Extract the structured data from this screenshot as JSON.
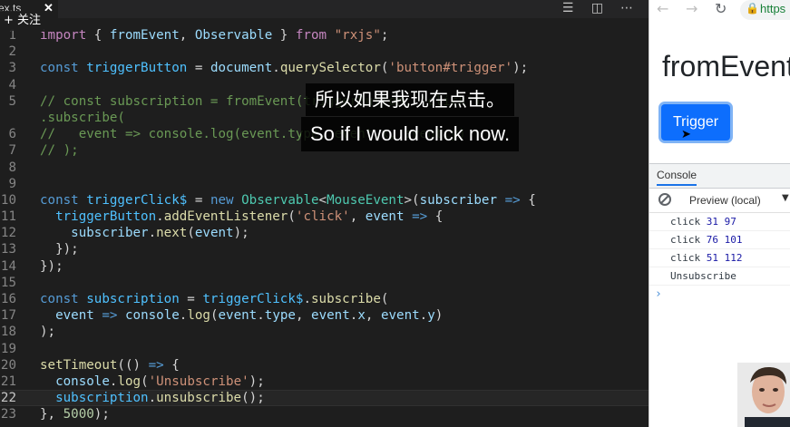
{
  "editor": {
    "tab": {
      "label": "ex.ts",
      "close": "✕"
    },
    "follow_badge": "+ 关注",
    "actions": [
      "☰",
      "◫",
      "⋯"
    ],
    "lines": [
      {
        "n": "1",
        "html": "<span class=\"kw\">import</span> { <span class=\"var\">fromEvent</span>, <span class=\"var\">Observable</span> } <span class=\"kw\">from</span> <span class=\"str\">\"rxjs\"</span>;"
      },
      {
        "n": "2",
        "html": ""
      },
      {
        "n": "3",
        "html": "<span class=\"decl\">const</span> <span class=\"const\">triggerButton</span> = <span class=\"var\">document</span>.<span class=\"fn\">querySelector</span>(<span class=\"str\">'button#trigger'</span>);"
      },
      {
        "n": "4",
        "html": ""
      },
      {
        "n": "5",
        "html": "<span class=\"cmt\">// const subscription = fromEvent(triggerButton, 'click')</span>"
      },
      {
        "n": "",
        "html": "<span class=\"cmt\">.subscribe(</span>"
      },
      {
        "n": "6",
        "html": "<span class=\"cmt\">//   event =&gt; console.log(event.type, event.x, event.y)</span>"
      },
      {
        "n": "7",
        "html": "<span class=\"cmt\">// );</span>"
      },
      {
        "n": "8",
        "html": ""
      },
      {
        "n": "9",
        "html": ""
      },
      {
        "n": "10",
        "html": "<span class=\"decl\">const</span> <span class=\"const\">triggerClick$</span> = <span class=\"decl\">new</span> <span class=\"cls\">Observable</span>&lt;<span class=\"cls\">MouseEvent</span>&gt;(<span class=\"var\">subscriber</span> <span class=\"decl\">=&gt;</span> {"
      },
      {
        "n": "11",
        "html": "  <span class=\"const\">triggerButton</span>.<span class=\"fn\">addEventListener</span>(<span class=\"str\">'click'</span>, <span class=\"var\">event</span> <span class=\"decl\">=&gt;</span> {"
      },
      {
        "n": "12",
        "html": "    <span class=\"var\">subscriber</span>.<span class=\"fn\">next</span>(<span class=\"var\">event</span>);"
      },
      {
        "n": "13",
        "html": "  });"
      },
      {
        "n": "14",
        "html": "});"
      },
      {
        "n": "15",
        "html": ""
      },
      {
        "n": "16",
        "html": "<span class=\"decl\">const</span> <span class=\"const\">subscription</span> = <span class=\"const\">triggerClick$</span>.<span class=\"fn\">subscribe</span>("
      },
      {
        "n": "17",
        "html": "  <span class=\"var\">event</span> <span class=\"decl\">=&gt;</span> <span class=\"var\">console</span>.<span class=\"fn\">log</span>(<span class=\"var\">event</span>.<span class=\"var\">type</span>, <span class=\"var\">event</span>.<span class=\"var\">x</span>, <span class=\"var\">event</span>.<span class=\"var\">y</span>)"
      },
      {
        "n": "18",
        "html": ");"
      },
      {
        "n": "19",
        "html": ""
      },
      {
        "n": "20",
        "html": "<span class=\"fn\">setTimeout</span>(() <span class=\"decl\">=&gt;</span> {"
      },
      {
        "n": "21",
        "html": "  <span class=\"var\">console</span>.<span class=\"fn\">log</span>(<span class=\"str\">'Unsubscribe'</span>);"
      },
      {
        "n": "22",
        "html": "  <span class=\"const\">subscription</span>.<span class=\"fn\">unsubscribe</span>();"
      },
      {
        "n": "23",
        "html": "}, <span class=\"num\">5000</span>);"
      }
    ],
    "current_line": "22"
  },
  "subtitles": {
    "zh": "所以如果我现在点击。",
    "en": "So if I would click now."
  },
  "browser": {
    "back": "←",
    "forward": "→",
    "reload": "↻",
    "lock": "🔒",
    "url": "https",
    "heading": "fromEvent",
    "trigger_label": "Trigger",
    "cursor": "➤"
  },
  "devtools": {
    "tab": "Console",
    "context": "Preview (local)",
    "chevron": "▼",
    "logs": [
      {
        "label": "click",
        "nums": "31 97"
      },
      {
        "label": "click",
        "nums": "76 101"
      },
      {
        "label": "click",
        "nums": "51 112"
      },
      {
        "label": "Unsubscribe",
        "nums": ""
      }
    ],
    "prompt": "›"
  }
}
